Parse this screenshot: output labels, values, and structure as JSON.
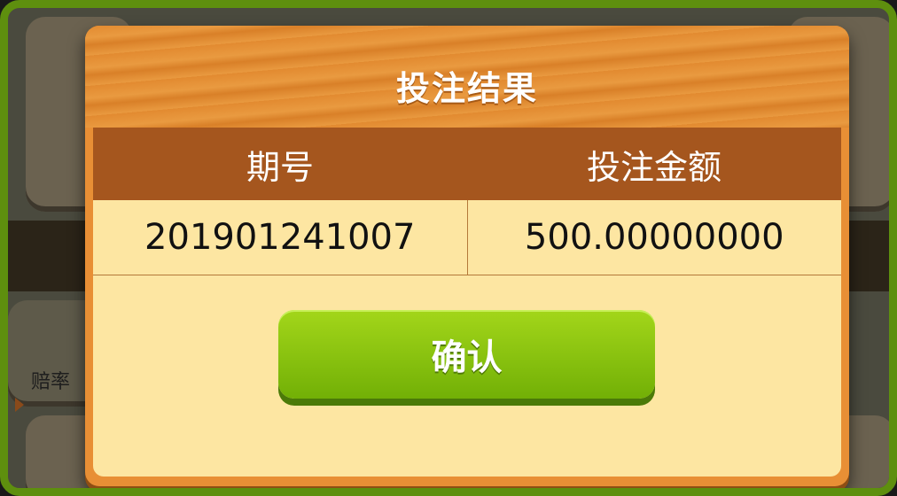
{
  "background": {
    "partial_label": "赔率"
  },
  "dialog": {
    "title": "投注结果",
    "columns": [
      "期号",
      "投注金额"
    ],
    "row": {
      "period": "201901241007",
      "amount": "500.00000000"
    },
    "confirm_label": "确认"
  },
  "colors": {
    "frame": "#5e8f0e",
    "dialog": "#e88f35",
    "header": "#a5561e",
    "panel": "#fde6a2",
    "button": "#8ac40f"
  }
}
